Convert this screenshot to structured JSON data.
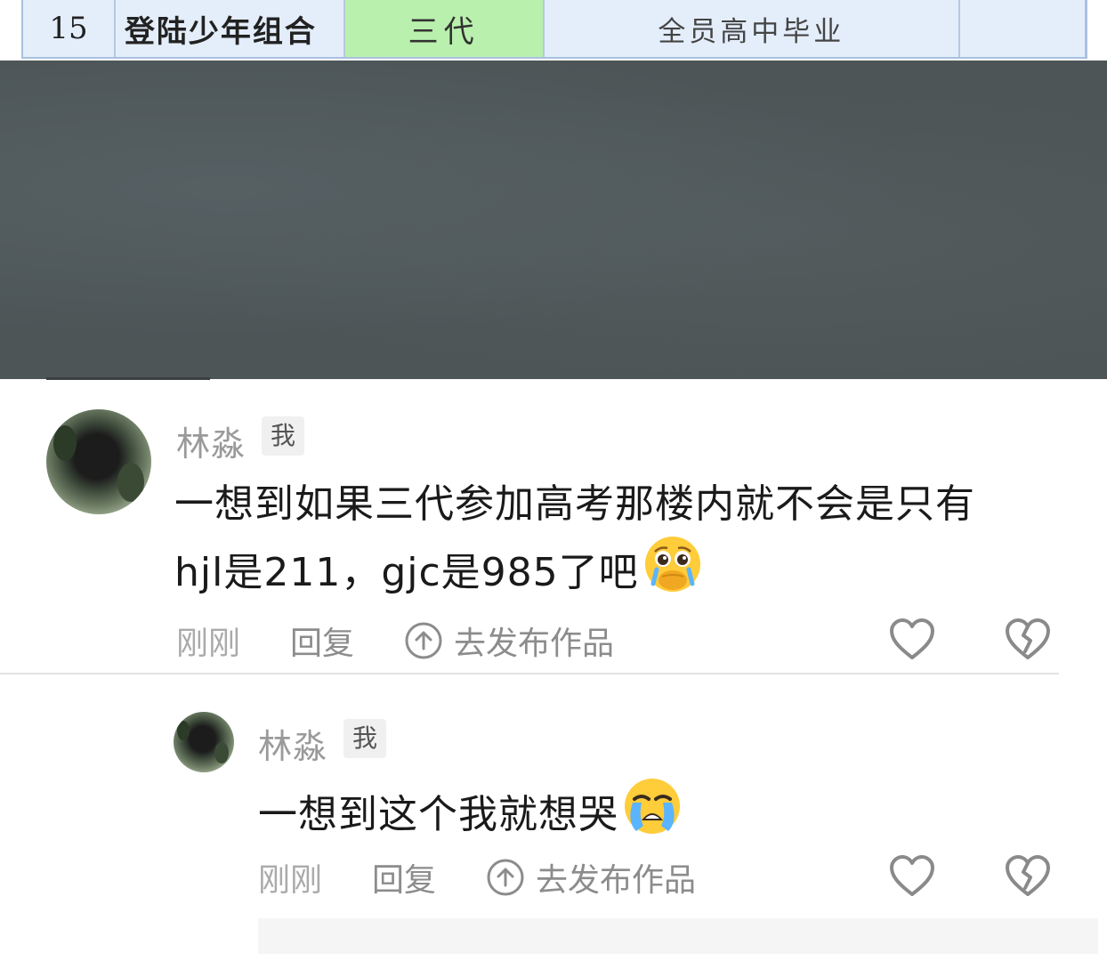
{
  "table_row": {
    "number": "15",
    "name": "登陆少年组合",
    "generation": "三代",
    "note": "全员高中毕业"
  },
  "comments": [
    {
      "username": "林淼",
      "badge": "我",
      "text_line1": "一想到如果三代参加高考那楼内就不会是只有",
      "text_line2": "hjl是211，gjc是985了吧",
      "emoji": "pleading-face-covering-mouth",
      "time": "刚刚",
      "reply_label": "回复",
      "publish_label": "去发布作品"
    },
    {
      "username": "林淼",
      "badge": "我",
      "text_line1": "一想到这个我就想哭",
      "emoji": "loudly-crying-face",
      "time": "刚刚",
      "reply_label": "回复",
      "publish_label": "去发布作品"
    }
  ],
  "colors": {
    "video_bg": "#4d5557",
    "generation_cell": "#b9f0ad",
    "table_row_bg": "#e4eefb",
    "meta_text": "#9a9a9a"
  }
}
